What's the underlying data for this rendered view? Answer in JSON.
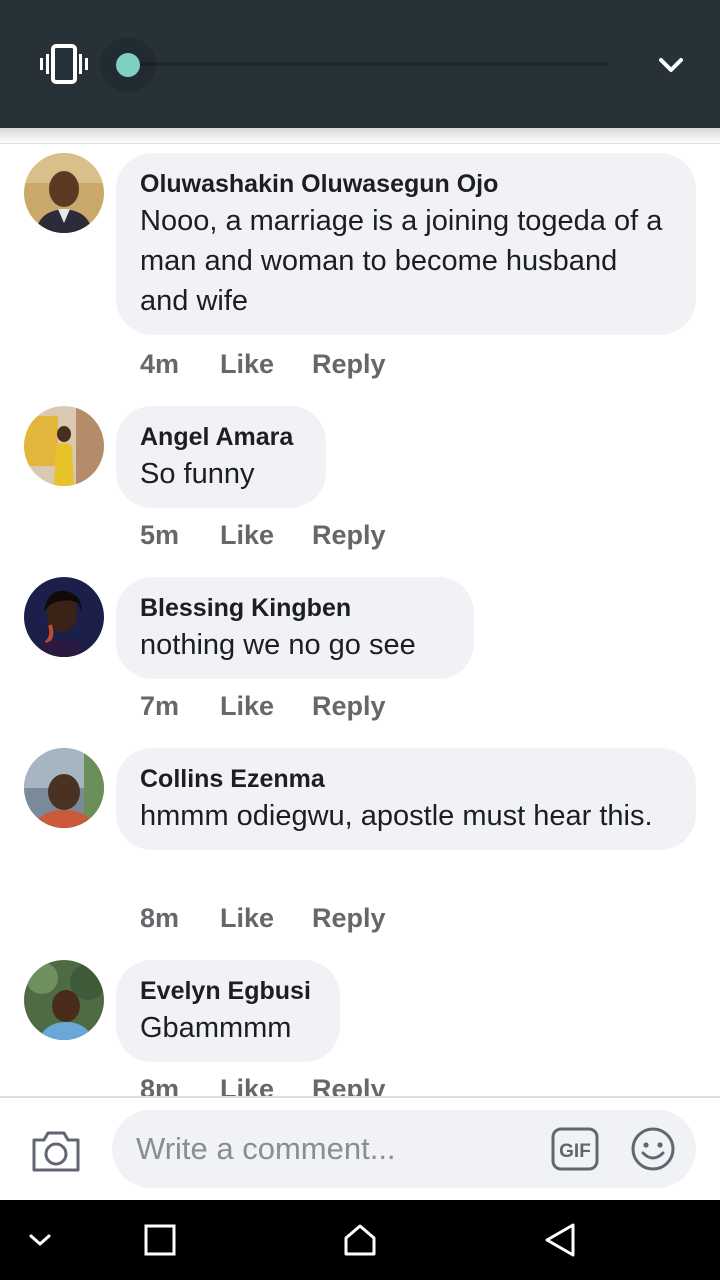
{
  "composer": {
    "placeholder": "Write a comment...",
    "gif_label": "GIF"
  },
  "actions": {
    "like": "Like",
    "reply": "Reply"
  },
  "comments": [
    {
      "author": "Oluwashakin Oluwasegun Ojo",
      "text": "Nooo, a marriage is a joining togeda of a man and woman to become husband and wife",
      "time": "4m"
    },
    {
      "author": "Angel Amara",
      "text": "So funny",
      "time": "5m"
    },
    {
      "author": "Blessing Kingben",
      "text": "nothing we no go see",
      "time": "7m"
    },
    {
      "author": "Collins Ezenma",
      "text": "hmmm odiegwu, apostle must hear this.",
      "time": "8m"
    },
    {
      "author": "Evelyn Egbusi",
      "text": "Gbammmm",
      "time": "8m"
    }
  ],
  "icons": {
    "volume_mode": "vibrate-icon",
    "expand": "chevron-down-icon",
    "camera": "camera-icon",
    "gif": "gif-icon",
    "emoji": "emoji-icon",
    "nav": [
      "chevron-down-icon",
      "recents-square-icon",
      "home-icon",
      "back-triangle-icon"
    ]
  },
  "colors": {
    "panel": "#263238",
    "slider_thumb": "#7fcfc2",
    "bubble": "#f0f2f5"
  }
}
